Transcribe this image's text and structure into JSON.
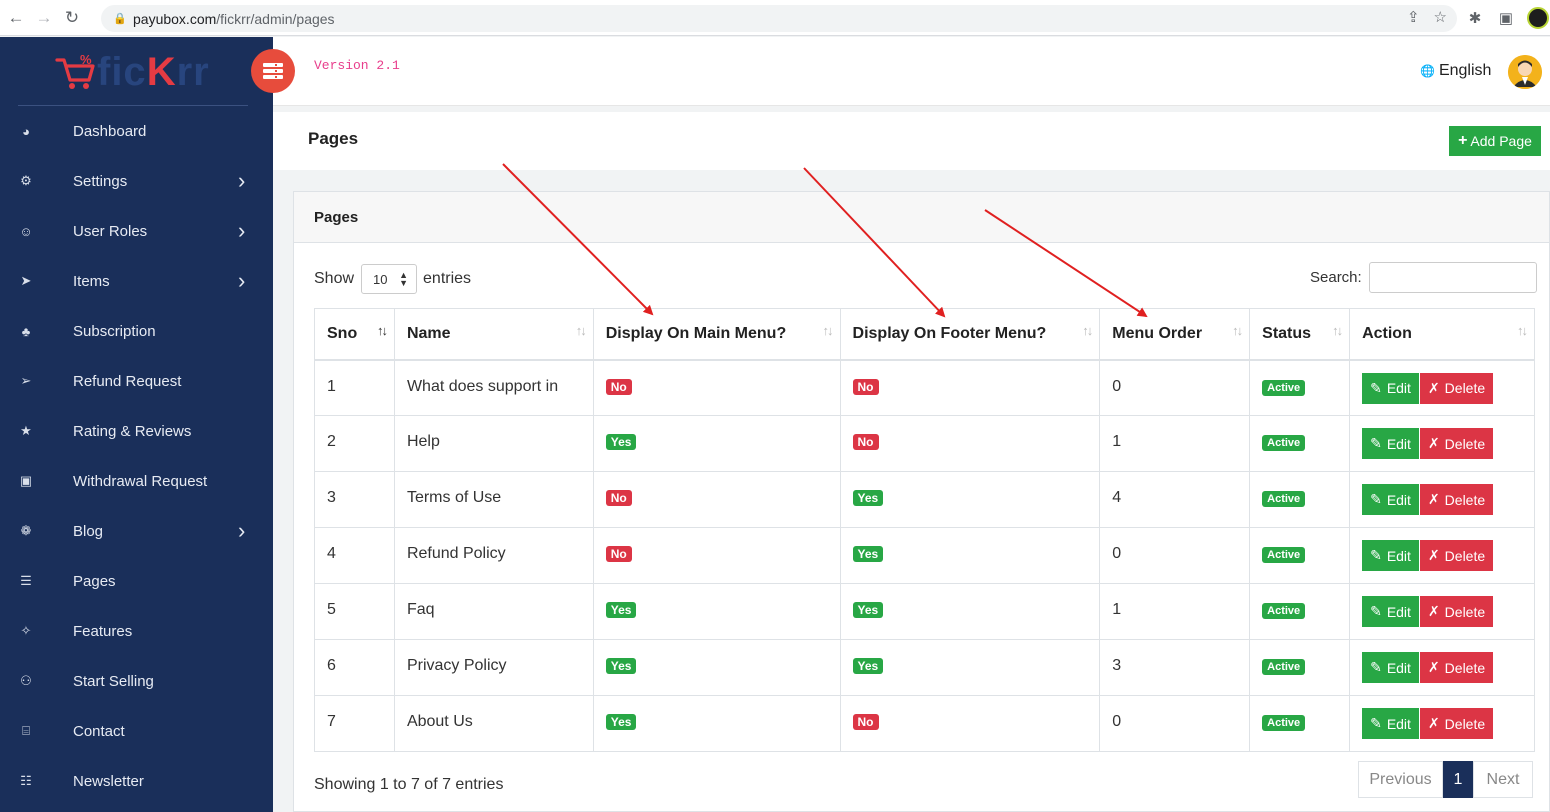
{
  "browser": {
    "url_host": "payubox.com",
    "url_path": "/fickrr/admin/pages"
  },
  "brand": {
    "part1": "fic",
    "part2": "K",
    "part3": "rr"
  },
  "header": {
    "version": "Version 2.1",
    "language": "English"
  },
  "sidebar": {
    "items": [
      {
        "label": "Dashboard",
        "icon": "dashboard-icon",
        "has_sub": false
      },
      {
        "label": "Settings",
        "icon": "gears-icon",
        "has_sub": true
      },
      {
        "label": "User Roles",
        "icon": "users-icon",
        "has_sub": true
      },
      {
        "label": "Items",
        "icon": "location-arrow-icon",
        "has_sub": true
      },
      {
        "label": "Subscription",
        "icon": "user-icon",
        "has_sub": false
      },
      {
        "label": "Refund Request",
        "icon": "paper-plane-icon",
        "has_sub": false
      },
      {
        "label": "Rating & Reviews",
        "icon": "star-icon",
        "has_sub": false
      },
      {
        "label": "Withdrawal Request",
        "icon": "money-icon",
        "has_sub": false
      },
      {
        "label": "Blog",
        "icon": "comments-icon",
        "has_sub": true
      },
      {
        "label": "Pages",
        "icon": "file-icon",
        "has_sub": false
      },
      {
        "label": "Features",
        "icon": "magic-icon",
        "has_sub": false
      },
      {
        "label": "Start Selling",
        "icon": "cart-icon",
        "has_sub": false
      },
      {
        "label": "Contact",
        "icon": "address-book-icon",
        "has_sub": false
      },
      {
        "label": "Newsletter",
        "icon": "newspaper-icon",
        "has_sub": false
      }
    ]
  },
  "page": {
    "title": "Pages",
    "add_button": "Add Page"
  },
  "card": {
    "title": "Pages",
    "show_label": "Show",
    "entries_value": "10",
    "entries_label": "entries",
    "search_label": "Search:",
    "columns": [
      "Sno",
      "Name",
      "Display On Main Menu?",
      "Display On Footer Menu?",
      "Menu Order",
      "Status",
      "Action"
    ],
    "rows": [
      {
        "sno": "1",
        "name": "What does support in",
        "main": "No",
        "footer": "No",
        "order": "0",
        "status": "Active"
      },
      {
        "sno": "2",
        "name": "Help",
        "main": "Yes",
        "footer": "No",
        "order": "1",
        "status": "Active"
      },
      {
        "sno": "3",
        "name": "Terms of Use",
        "main": "No",
        "footer": "Yes",
        "order": "4",
        "status": "Active"
      },
      {
        "sno": "4",
        "name": "Refund Policy",
        "main": "No",
        "footer": "Yes",
        "order": "0",
        "status": "Active"
      },
      {
        "sno": "5",
        "name": "Faq",
        "main": "Yes",
        "footer": "Yes",
        "order": "1",
        "status": "Active"
      },
      {
        "sno": "6",
        "name": "Privacy Policy",
        "main": "Yes",
        "footer": "Yes",
        "order": "3",
        "status": "Active"
      },
      {
        "sno": "7",
        "name": "About Us",
        "main": "Yes",
        "footer": "No",
        "order": "0",
        "status": "Active"
      }
    ],
    "edit_label": "Edit",
    "delete_label": "Delete",
    "info": "Showing 1 to 7 of 7 entries",
    "pager": {
      "prev": "Previous",
      "current": "1",
      "next": "Next"
    }
  },
  "colors": {
    "sidebar": "#1a2f5a",
    "success": "#28a745",
    "danger": "#dc3545",
    "accent": "#e74c3c",
    "annotation": "#e02020"
  }
}
